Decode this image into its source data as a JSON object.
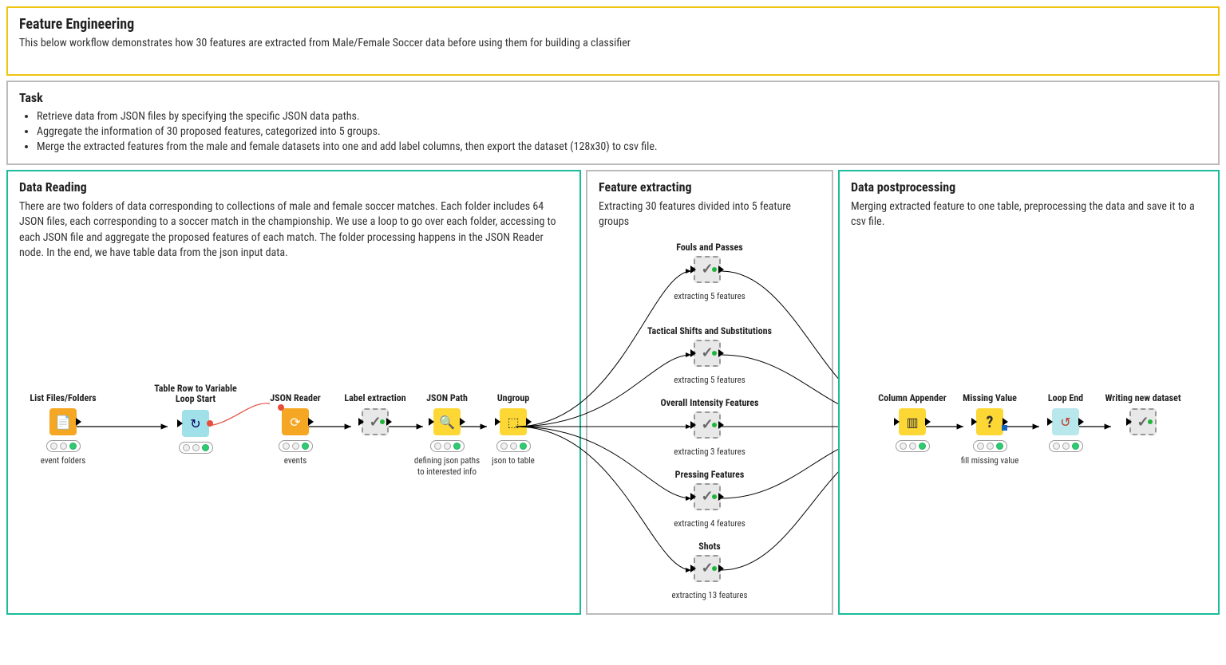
{
  "banner": {
    "title": "Feature Engineering",
    "desc": "This below workflow demonstrates how 30 features are extracted from Male/Female Soccer data before using them for building a classifier"
  },
  "task": {
    "title": "Task",
    "items": [
      "Retrieve data from JSON files by specifying the specific JSON data paths.",
      "Aggregate the information of 30 proposed features, categorized into 5 groups.",
      "Merge the extracted features from the male and female datasets into one and add label columns, then export the dataset (128x30) to csv file."
    ]
  },
  "data_reading": {
    "title": "Data Reading",
    "desc": "There are two folders of data corresponding to collections of male and female soccer matches. Each folder includes 64 JSON files, each corresponding to a soccer match in the championship. We use a loop to go over each folder, accessing to each JSON file and aggregate the proposed features of each match. The folder processing happens in the JSON Reader node. In the end, we have table data from the json input data."
  },
  "feature_extract": {
    "title": "Feature extracting",
    "desc": "Extracting 30 features divided into 5 feature groups",
    "groups": [
      {
        "name": "Fouls and Passes",
        "caption": "extracting 5 features"
      },
      {
        "name": "Tactical Shifts and Substitutions",
        "caption": "extracting 5 features"
      },
      {
        "name": "Overall Intensity Features",
        "caption": "extracting 3 features"
      },
      {
        "name": "Pressing Features",
        "caption": "extracting 4 features"
      },
      {
        "name": "Shots",
        "caption": "extracting 13 features"
      }
    ]
  },
  "data_post": {
    "title": "Data postprocessing",
    "desc": "Merging extracted feature to one table, preprocessing the data and save it to a csv file."
  },
  "nodes": {
    "list_files": {
      "title": "List Files/Folders",
      "caption": "event folders"
    },
    "loop_start": {
      "title": "Table Row to Variable Loop Start",
      "caption": ""
    },
    "json_reader": {
      "title": "JSON Reader",
      "caption": "events"
    },
    "label_ext": {
      "title": "Label extraction",
      "caption": ""
    },
    "json_path": {
      "title": "JSON Path",
      "caption": "defining json paths to interested info"
    },
    "ungroup": {
      "title": "Ungroup",
      "caption": "json to table"
    },
    "col_app": {
      "title": "Column Appender",
      "caption": ""
    },
    "missing": {
      "title": "Missing Value",
      "caption": "fill missing value"
    },
    "loop_end": {
      "title": "Loop End",
      "caption": ""
    },
    "write": {
      "title": "Writing new dataset",
      "caption": ""
    }
  }
}
